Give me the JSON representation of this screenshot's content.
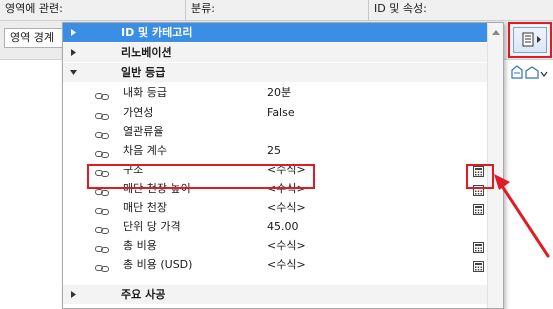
{
  "background": {
    "header_columns": [
      "영역에 관련:",
      "분류:",
      "ID 및 속성:"
    ],
    "dropdown_value": "영역 경계"
  },
  "popup": {
    "rows": [
      {
        "kind": "group",
        "expanded": false,
        "selected": true,
        "label": "ID 및 카테고리"
      },
      {
        "kind": "group",
        "expanded": false,
        "selected": false,
        "label": "리노베이션"
      },
      {
        "kind": "group",
        "expanded": true,
        "selected": false,
        "label": "일반 등급"
      },
      {
        "kind": "prop",
        "label": "내화 등급",
        "value": "20분",
        "calc": false
      },
      {
        "kind": "prop",
        "label": "가연성",
        "value": "False",
        "calc": false
      },
      {
        "kind": "prop",
        "label": "열관류율",
        "value": "",
        "calc": false
      },
      {
        "kind": "prop",
        "label": "차음 계수",
        "value": "25",
        "calc": false
      },
      {
        "kind": "prop",
        "label": "구조",
        "value": "<수식>",
        "calc": true
      },
      {
        "kind": "prop",
        "label": "매단 천장 높이",
        "value": "<수식>",
        "calc": true
      },
      {
        "kind": "prop",
        "label": "매단 천장",
        "value": "<수식>",
        "calc": true
      },
      {
        "kind": "prop",
        "label": "단위 당 가격",
        "value": "45.00",
        "calc": false
      },
      {
        "kind": "prop",
        "label": "총 비용",
        "value": "<수식>",
        "calc": true
      },
      {
        "kind": "prop",
        "label": "총 비용 (USD)",
        "value": "<수식>",
        "calc": true
      },
      {
        "kind": "group",
        "expanded": false,
        "selected": false,
        "label": "주요 사공"
      }
    ]
  },
  "icons": {
    "group_collapsed": "triangle-right-icon",
    "group_expanded": "triangle-down-icon",
    "property_link": "link-chain-icon",
    "formula": "calculator-icon",
    "settings": "document-settings-icon",
    "scroll_up": "scroll-up-arrow-icon"
  },
  "colors": {
    "selected_row": "#3a8ee6",
    "highlight": "#e01b24"
  }
}
